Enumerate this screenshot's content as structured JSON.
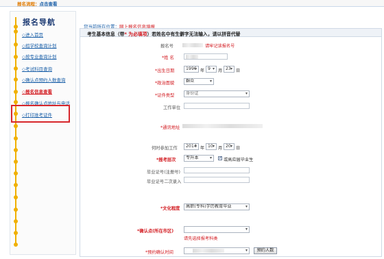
{
  "topbar": {
    "prefix": "报名流程：",
    "current": "点击查看"
  },
  "sidebar": {
    "title": "报名导航",
    "items": [
      {
        "label": "◇进入首页",
        "active": false
      },
      {
        "label": "◇招学校查询计划",
        "active": false
      },
      {
        "label": "◇按专业查询计划",
        "active": false
      },
      {
        "label": "◇考试科目查询",
        "active": false
      },
      {
        "label": "◇确认点预约人数查询",
        "active": false
      },
      {
        "label": "◇报名信息查看",
        "active": true
      },
      {
        "label": "◇报名确认点地址与电话",
        "active": false
      },
      {
        "label": "◇打印准考证件",
        "active": false
      }
    ]
  },
  "location": {
    "prefix": "您当前所在位置：",
    "here": "网上报名信息填报"
  },
  "panel": {
    "title_a": "考生基本信息（带",
    "title_star": "* 为必填项",
    "title_b": "）若姓名中有生僻字无法输入，请以拼音代替"
  },
  "form": {
    "signup_no": {
      "label": "报名号",
      "hint": "请牢记该报名号"
    },
    "name": {
      "label": "*姓 名"
    },
    "birth": {
      "label": "*出生日期",
      "year": "1996",
      "month": "9",
      "day": "23",
      "u_year": "年",
      "u_month": "月",
      "u_day": "日"
    },
    "politics": {
      "label": "*政治面貌",
      "value": "群众"
    },
    "id_type": {
      "label": "*证件类型",
      "value": "身份证"
    },
    "workplace": {
      "label": "工作单位"
    },
    "address": {
      "label": "*通讯地址"
    },
    "work_date": {
      "label": "何时参加工作",
      "year": "2014",
      "month": "10",
      "day": "20",
      "u_year": "年",
      "u_month": "月",
      "u_day": "日"
    },
    "level": {
      "label": "*报考层次",
      "value": "专升本",
      "check_label": "或高应届毕业生"
    },
    "grad_no": {
      "label": "毕业证号(注册号)"
    },
    "grad_no2": {
      "label": "毕业证号二次录入"
    },
    "education": {
      "label": "*文化程度",
      "value": "高职(专科)学历教育毕业"
    },
    "confirm_point": {
      "label": "*确认点(所在市区)",
      "hint": "请先选择报考科类"
    },
    "confirm_time": {
      "label": "*预约确认时间",
      "button": "预约人数"
    }
  }
}
